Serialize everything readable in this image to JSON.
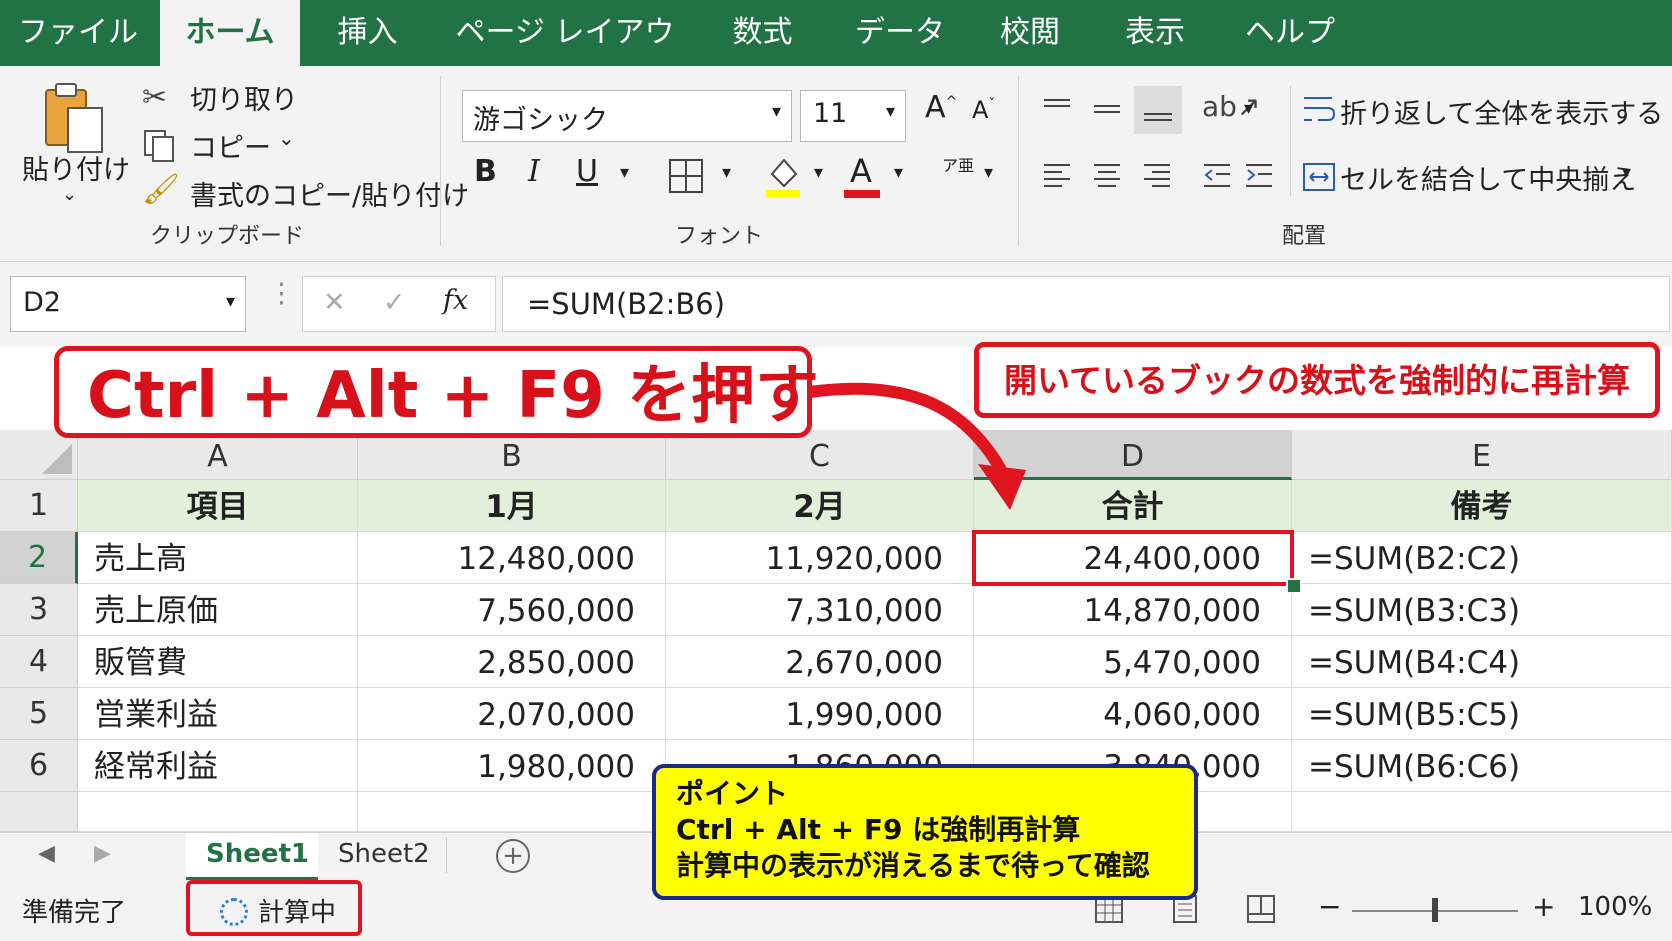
{
  "ribbon_tabs": [
    "ファイル",
    "ホーム",
    "挿入",
    "ページ レイアウト",
    "数式",
    "データ",
    "校閲",
    "表示",
    "ヘルプ"
  ],
  "clipboard": {
    "paste": "貼り付け",
    "cut": "切り取り",
    "copy": "コピー",
    "format_painter": "書式のコピー/貼り付け",
    "group": "クリップボード"
  },
  "font": {
    "name": "游ゴシック",
    "size": "11",
    "bold": "B",
    "italic": "I",
    "underline": "U",
    "font_color_letter": "A",
    "phonetic": "ア亜",
    "group": "フォント"
  },
  "alignment": {
    "wrap_text": "折り返して全体を表示する",
    "merge_center": "セルを結合して中央揃え",
    "group": "配置"
  },
  "formula_bar": {
    "name_box": "D2",
    "cancel": "✕",
    "enter": "✓",
    "fx": "fx",
    "formula": "=SUM(B2:B6)"
  },
  "grid": {
    "columns": [
      "A",
      "B",
      "C",
      "D",
      "E"
    ],
    "rows": [
      {
        "num": "1",
        "cells": [
          "項目",
          "1月",
          "2月",
          "合計",
          "備考"
        ]
      },
      {
        "num": "2",
        "cells": [
          "売上高",
          "12,480,000",
          "11,920,000",
          "24,400,000",
          "=SUM(B2:C2)"
        ]
      },
      {
        "num": "3",
        "cells": [
          "売上原価",
          "7,560,000",
          "7,310,000",
          "14,870,000",
          "=SUM(B3:C3)"
        ]
      },
      {
        "num": "4",
        "cells": [
          "販管費",
          "2,850,000",
          "2,670,000",
          "5,470,000",
          "=SUM(B4:C4)"
        ]
      },
      {
        "num": "5",
        "cells": [
          "営業利益",
          "2,070,000",
          "1,990,000",
          "4,060,000",
          "=SUM(B5:C5)"
        ]
      },
      {
        "num": "6",
        "cells": [
          "経常利益",
          "1,980,000",
          "1,860,000",
          "3,840,000",
          "=SUM(B6:C6)"
        ]
      }
    ]
  },
  "sheets": {
    "active": "Sheet1",
    "other": "Sheet2",
    "add": "+"
  },
  "status": {
    "ready": "準備完了",
    "calculating": "計算中",
    "zoom": "100%",
    "zoom_minus": "−",
    "zoom_plus": "+"
  },
  "annotations": {
    "shortcut": "Ctrl + Alt + F9 を押す",
    "description": "開いているブックの数式を強制的に再計算",
    "point_title": "ポイント",
    "point_line1": "Ctrl + Alt + F9 は強制再計算",
    "point_line2": "計算中の表示が消えるまで待って確認"
  },
  "colors": {
    "excel_green": "#217346",
    "annotation_red": "#e0141e",
    "point_yellow": "#ffff00",
    "point_border": "#1a2a8a",
    "header_fill": "#e2efda"
  }
}
